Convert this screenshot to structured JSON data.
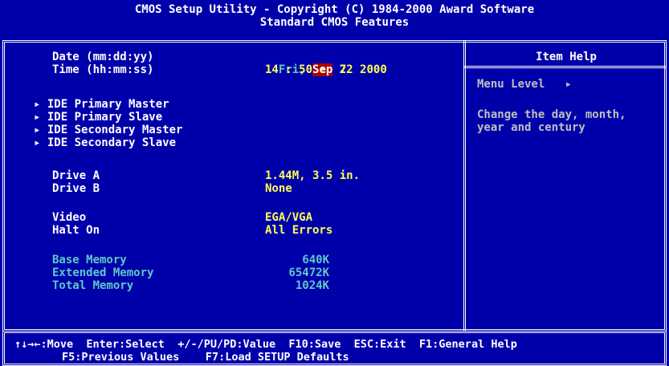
{
  "header": {
    "line1": "CMOS Setup Utility - Copyright (C) 1984-2000 Award Software",
    "line2": "Standard CMOS Features"
  },
  "fields": {
    "date_label": "Date (mm:dd:yy)",
    "time_label": "Time (hh:mm:ss)",
    "date_day": "Fri,",
    "date_month": "Sep",
    "date_rest": "22 2000",
    "time_value": "14 : 50 :  7",
    "ide": [
      "▸ IDE Primary Master",
      "▸ IDE Primary Slave",
      "▸ IDE Secondary Master",
      "▸ IDE Secondary Slave"
    ],
    "drive_a_label": "Drive A",
    "drive_a_value": "1.44M, 3.5 in.",
    "drive_b_label": "Drive B",
    "drive_b_value": "None",
    "video_label": "Video",
    "video_value": "EGA/VGA",
    "halt_label": "Halt On",
    "halt_value": "All Errors",
    "base_mem_label": "Base Memory",
    "base_mem_value": "640K",
    "ext_mem_label": "Extended Memory",
    "ext_mem_value": "65472K",
    "total_mem_label": "Total Memory",
    "total_mem_value": "1024K"
  },
  "help": {
    "title": "Item Help",
    "menu_level": "Menu Level   ▸",
    "text_line1": "Change the day, month,",
    "text_line2": "year and century"
  },
  "footer": {
    "line1": "↑↓→←:Move  Enter:Select  +/-/PU/PD:Value  F10:Save  ESC:Exit  F1:General Help",
    "line2": "F5:Previous Values    F7:Load SETUP Defaults"
  },
  "colors": {
    "background": "#0000aa",
    "value_yellow": "#ffff55",
    "selection_red": "#aa0000",
    "disabled_cyan": "#5fc8c8",
    "help_gray": "#c0c0c0"
  }
}
